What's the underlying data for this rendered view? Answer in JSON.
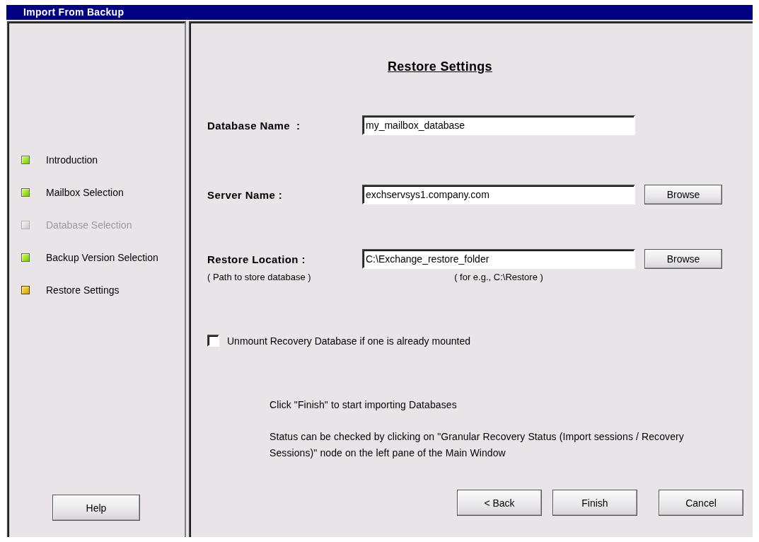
{
  "window": {
    "title": "Import From Backup"
  },
  "steps": [
    {
      "label": "Introduction",
      "completed": true,
      "current": false,
      "disabled": false
    },
    {
      "label": "Mailbox Selection",
      "completed": true,
      "current": false,
      "disabled": false
    },
    {
      "label": "Database Selection",
      "completed": false,
      "current": false,
      "disabled": true
    },
    {
      "label": "Backup Version Selection",
      "completed": true,
      "current": false,
      "disabled": false
    },
    {
      "label": "Restore Settings",
      "completed": false,
      "current": true,
      "disabled": false
    }
  ],
  "help_button": "Help",
  "heading": "Restore Settings",
  "fields": [
    {
      "label": "Database Name  :",
      "value": "my_mailbox_database"
    },
    {
      "label": "Server Name :",
      "value": "exchservsys1.company.com",
      "button": "Browse"
    },
    {
      "label": "Restore Location :",
      "value": "C:\\Exchange_restore_folder",
      "button": "Browse",
      "hint": "( Path to store database )",
      "example": "( for e.g., C:\\Restore )"
    }
  ],
  "unmount_option": {
    "label": "Unmount Recovery Database if one is already mounted",
    "checked": false
  },
  "notes": [
    "Click \"Finish\" to start importing Databases",
    "Status can be checked by clicking on \"Granular Recovery Status (Import sessions / Recovery Sessions)\" node on the left pane of the Main Window"
  ],
  "buttons": [
    "< Back",
    "Finish",
    "Cancel"
  ]
}
